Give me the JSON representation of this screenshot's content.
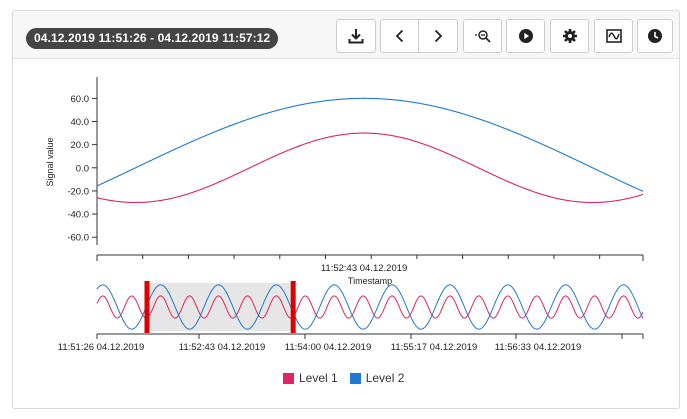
{
  "header": {
    "time_range": "04.12.2019 11:51:26 - 04.12.2019 11:57:12",
    "buttons": [
      {
        "name": "download-button",
        "icon": "download-icon"
      },
      {
        "name": "previous-button",
        "icon": "chevron-left-icon"
      },
      {
        "name": "next-button",
        "icon": "chevron-right-icon"
      },
      {
        "name": "zoom-out-button",
        "icon": "zoom-out-icon"
      },
      {
        "name": "play-button",
        "icon": "play-icon"
      },
      {
        "name": "settings-button",
        "icon": "gear-icon"
      },
      {
        "name": "signal-button",
        "icon": "signal-wave-icon"
      },
      {
        "name": "history-button",
        "icon": "clock-icon"
      }
    ]
  },
  "chart_data": [
    {
      "type": "line",
      "ylabel": "Signal value",
      "xlabel": "Timestamp",
      "ylim": [
        -65,
        75
      ],
      "yticks": [
        "60.0",
        "40.0",
        "20.0",
        "0.0",
        "-20.0",
        "-40.0",
        "-60.0"
      ],
      "ytick_values": [
        60,
        40,
        20,
        0,
        -20,
        -40,
        -60
      ],
      "xticks": [
        "11:52:43 04.12.2019"
      ],
      "series": [
        {
          "name": "Level 1",
          "color": "#e0245e",
          "amplitude": 30,
          "period_s": 77,
          "phase": 0
        },
        {
          "name": "Level 2",
          "color": "#1f78d1",
          "amplitude": 60,
          "period_s": 154,
          "phase": 0
        }
      ],
      "x_window": [
        "11:51:58",
        "11:53:30"
      ]
    },
    {
      "type": "line",
      "role": "navigator",
      "xticks": [
        "11:51:26 04.12.2019",
        "11:52:43 04.12.2019",
        "11:54:00 04.12.2019",
        "11:55:17 04.12.2019",
        "11:56:33 04.12.2019"
      ],
      "selection": [
        "11:51:58",
        "11:53:30"
      ],
      "x_range": [
        "11:51:26",
        "11:57:12"
      ]
    }
  ],
  "legend": [
    {
      "label": "Level 1",
      "color": "#e0245e"
    },
    {
      "label": "Level 2",
      "color": "#1f78d1"
    }
  ]
}
